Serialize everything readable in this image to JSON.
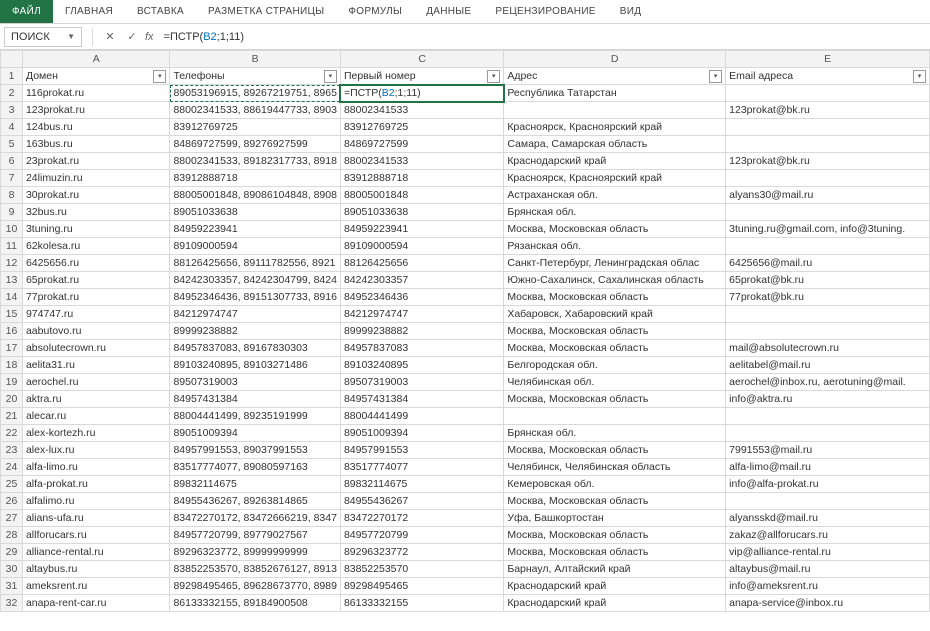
{
  "ribbon": {
    "tabs": [
      "ФАЙЛ",
      "ГЛАВНАЯ",
      "ВСТАВКА",
      "РАЗМЕТКА СТРАНИЦЫ",
      "ФОРМУЛЫ",
      "ДАННЫЕ",
      "РЕЦЕНЗИРОВАНИЕ",
      "ВИД"
    ],
    "active_index": 0
  },
  "formula_bar": {
    "name_box": "ПОИСК",
    "fx": "fx",
    "formula_prefix": "=ПСТР(",
    "formula_ref": "B2",
    "formula_suffix": ";1;11)"
  },
  "columns": [
    "A",
    "B",
    "C",
    "D",
    "E"
  ],
  "header_row": {
    "num": "1",
    "cells": [
      "Домен",
      "Телефоны",
      "Первый номер",
      "Адрес",
      "Email адреса"
    ]
  },
  "active_cell": {
    "row": "2",
    "col": "C",
    "display_prefix": "=ПСТР(",
    "display_ref": "B2",
    "display_suffix": ";1;11)"
  },
  "rows": [
    {
      "n": "2",
      "d": "116prokat.ru",
      "t": "89053196915, 89267219751, 8965",
      "p": "",
      "a": "Республика Татарстан",
      "e": ""
    },
    {
      "n": "3",
      "d": "123prokat.ru",
      "t": "88002341533, 88619447733, 8903",
      "p": "88002341533",
      "a": "",
      "e": "123prokat@bk.ru"
    },
    {
      "n": "4",
      "d": "124bus.ru",
      "t": "83912769725",
      "p": "83912769725",
      "a": "Красноярск, Красноярский край",
      "e": ""
    },
    {
      "n": "5",
      "d": "163bus.ru",
      "t": "84869727599, 89276927599",
      "p": "84869727599",
      "a": "Самара, Самарская область",
      "e": ""
    },
    {
      "n": "6",
      "d": "23prokat.ru",
      "t": "88002341533, 89182317733, 8918",
      "p": "88002341533",
      "a": "Краснодарский край",
      "e": "123prokat@bk.ru"
    },
    {
      "n": "7",
      "d": "24limuzin.ru",
      "t": "83912888718",
      "p": "83912888718",
      "a": "Красноярск, Красноярский край",
      "e": ""
    },
    {
      "n": "8",
      "d": "30prokat.ru",
      "t": "88005001848, 89086104848, 8908",
      "p": "88005001848",
      "a": "Астраханская обл.",
      "e": "alyans30@mail.ru"
    },
    {
      "n": "9",
      "d": "32bus.ru",
      "t": "89051033638",
      "p": "89051033638",
      "a": "Брянская обл.",
      "e": ""
    },
    {
      "n": "10",
      "d": "3tuning.ru",
      "t": "84959223941",
      "p": "84959223941",
      "a": "Москва, Московская область",
      "e": "3tuning.ru@gmail.com, info@3tuning."
    },
    {
      "n": "11",
      "d": "62kolesa.ru",
      "t": "89109000594",
      "p": "89109000594",
      "a": "Рязанская обл.",
      "e": ""
    },
    {
      "n": "12",
      "d": "6425656.ru",
      "t": "88126425656, 89111782556, 8921",
      "p": "88126425656",
      "a": "Санкт-Петербург, Ленинградская облас",
      "e": "6425656@mail.ru"
    },
    {
      "n": "13",
      "d": "65prokat.ru",
      "t": "84242303357, 84242304799, 8424",
      "p": "84242303357",
      "a": "Южно-Сахалинск, Сахалинская область",
      "e": "65prokat@bk.ru"
    },
    {
      "n": "14",
      "d": "77prokat.ru",
      "t": "84952346436, 89151307733, 8916",
      "p": "84952346436",
      "a": "Москва, Московская область",
      "e": "77prokat@bk.ru"
    },
    {
      "n": "15",
      "d": "974747.ru",
      "t": "84212974747",
      "p": "84212974747",
      "a": "Хабаровск, Хабаровский край",
      "e": ""
    },
    {
      "n": "16",
      "d": "aabutovo.ru",
      "t": "89999238882",
      "p": "89999238882",
      "a": "Москва, Московская область",
      "e": ""
    },
    {
      "n": "17",
      "d": "absolutecrown.ru",
      "t": "84957837083, 89167830303",
      "p": "84957837083",
      "a": "Москва, Московская область",
      "e": "mail@absolutecrown.ru"
    },
    {
      "n": "18",
      "d": "aelita31.ru",
      "t": "89103240895, 89103271486",
      "p": "89103240895",
      "a": "Белгородская обл.",
      "e": "aelitabel@mail.ru"
    },
    {
      "n": "19",
      "d": "aerochel.ru",
      "t": "89507319003",
      "p": "89507319003",
      "a": "Челябинская обл.",
      "e": "aerochel@inbox.ru, aerotuning@mail."
    },
    {
      "n": "20",
      "d": "aktra.ru",
      "t": "84957431384",
      "p": "84957431384",
      "a": "Москва, Московская область",
      "e": "info@aktra.ru"
    },
    {
      "n": "21",
      "d": "alecar.ru",
      "t": "88004441499, 89235191999",
      "p": "88004441499",
      "a": "",
      "e": ""
    },
    {
      "n": "22",
      "d": "alex-kortezh.ru",
      "t": "89051009394",
      "p": "89051009394",
      "a": "Брянская обл.",
      "e": ""
    },
    {
      "n": "23",
      "d": "alex-lux.ru",
      "t": "84957991553, 89037991553",
      "p": "84957991553",
      "a": "Москва, Московская область",
      "e": "7991553@mail.ru"
    },
    {
      "n": "24",
      "d": "alfa-limo.ru",
      "t": "83517774077, 89080597163",
      "p": "83517774077",
      "a": "Челябинск, Челябинская область",
      "e": "alfa-limo@mail.ru"
    },
    {
      "n": "25",
      "d": "alfa-prokat.ru",
      "t": "89832114675",
      "p": "89832114675",
      "a": "Кемеровская обл.",
      "e": "info@alfa-prokat.ru"
    },
    {
      "n": "26",
      "d": "alfalimo.ru",
      "t": "84955436267, 89263814865",
      "p": "84955436267",
      "a": "Москва, Московская область",
      "e": ""
    },
    {
      "n": "27",
      "d": "alians-ufa.ru",
      "t": "83472270172, 83472666219, 8347",
      "p": "83472270172",
      "a": "Уфа, Башкортостан",
      "e": "alyansskd@mail.ru"
    },
    {
      "n": "28",
      "d": "allforucars.ru",
      "t": "84957720799, 89779027567",
      "p": "84957720799",
      "a": "Москва, Московская область",
      "e": "zakaz@allforucars.ru"
    },
    {
      "n": "29",
      "d": "alliance-rental.ru",
      "t": "89296323772, 89999999999",
      "p": "89296323772",
      "a": "Москва, Московская область",
      "e": "vip@alliance-rental.ru"
    },
    {
      "n": "30",
      "d": "altaybus.ru",
      "t": "83852253570, 83852676127, 8913",
      "p": "83852253570",
      "a": "Барнаул, Алтайский край",
      "e": "altaybus@mail.ru"
    },
    {
      "n": "31",
      "d": "ameksrent.ru",
      "t": "89298495465, 89628673770, 8989",
      "p": "89298495465",
      "a": "Краснодарский край",
      "e": "info@ameksrent.ru"
    },
    {
      "n": "32",
      "d": "anapa-rent-car.ru",
      "t": "86133332155, 89184900508",
      "p": "86133332155",
      "a": "Краснодарский край",
      "e": "anapa-service@inbox.ru"
    }
  ]
}
